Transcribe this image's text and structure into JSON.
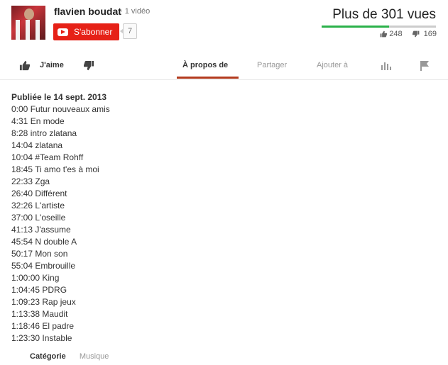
{
  "channel": {
    "name": "flavien boudat",
    "video_count": "· 1 vidéo",
    "subscribe_label": "S'abonner",
    "subscriber_count": "7"
  },
  "stats": {
    "views": "Plus de 301 vues",
    "likes": "248",
    "dislikes": "169",
    "like_fraction": 0.59,
    "colors": {
      "like_bar": "#2bb14a",
      "dislike_bar": "#cccccc"
    }
  },
  "actions": {
    "like_label": "J'aime",
    "tabs": [
      "À propos de",
      "Partager",
      "Ajouter à"
    ],
    "active_tab": "À propos de",
    "icons": [
      "thumbs-up-icon",
      "thumbs-down-icon",
      "stats-icon",
      "flag-icon"
    ]
  },
  "description": {
    "published": "Publiée le 14 sept. 2013",
    "tracks": [
      {
        "time": "0:00",
        "title": "Futur nouveaux amis"
      },
      {
        "time": "4:31",
        "title": "En mode"
      },
      {
        "time": "8:28",
        "title": "intro zlatana"
      },
      {
        "time": "14:04",
        "title": "zlatana"
      },
      {
        "time": "10:04",
        "title": "#Team Rohff"
      },
      {
        "time": "18:45",
        "title": "Ti amo t'es à moi"
      },
      {
        "time": "22:33",
        "title": "Zga"
      },
      {
        "time": "26:40",
        "title": "Différent"
      },
      {
        "time": "32:26",
        "title": "L'artiste"
      },
      {
        "time": "37:00",
        "title": "L'oseille"
      },
      {
        "time": "41:13",
        "title": "J'assume"
      },
      {
        "time": "45:54",
        "title": "N double A"
      },
      {
        "time": "50:17",
        "title": "Mon son"
      },
      {
        "time": "55:04",
        "title": "Embrouille"
      },
      {
        "time": "1:00:00",
        "title": "King"
      },
      {
        "time": "1:04:45",
        "title": "PDRG"
      },
      {
        "time": "1:09:23",
        "title": "Rap jeux"
      },
      {
        "time": "1:13:38",
        "title": "Maudit"
      },
      {
        "time": "1:18:46",
        "title": "El padre"
      },
      {
        "time": "1:23:30",
        "title": "Instable"
      }
    ]
  },
  "category": {
    "label": "Catégorie",
    "value": "Musique"
  }
}
